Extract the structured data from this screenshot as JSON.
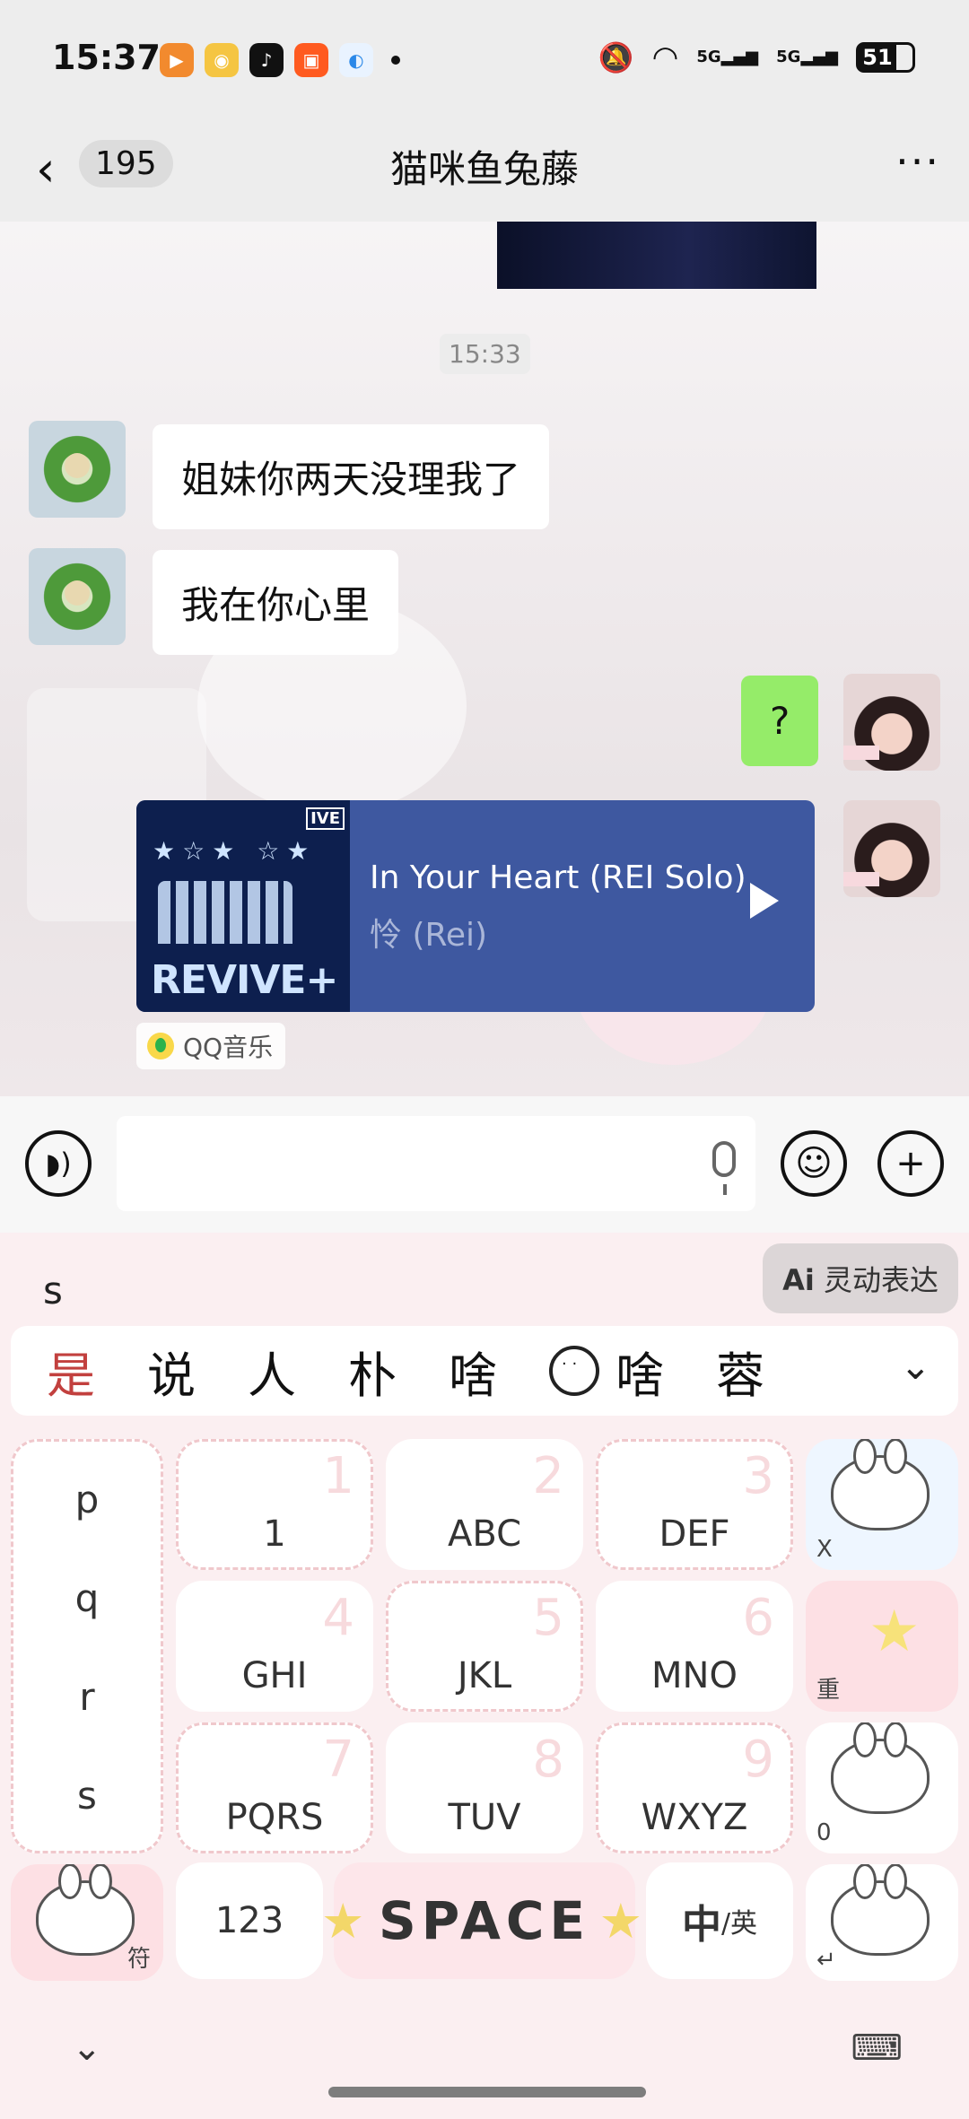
{
  "status_bar": {
    "time": "15:37",
    "app_icons": [
      "video-app-icon",
      "weibo-icon",
      "tiktok-icon",
      "kuaishou-icon",
      "browser-icon"
    ],
    "network_label_1": "5G",
    "network_label_2": "5G",
    "battery": "51"
  },
  "header": {
    "back_count": "195",
    "title": "猫咪鱼兔藤",
    "more": "···"
  },
  "chat": {
    "timestamp": "15:33",
    "messages": [
      {
        "side": "left",
        "text": "姐妹你两天没理我了"
      },
      {
        "side": "left",
        "text": "我在你心里"
      },
      {
        "side": "right",
        "text": "?"
      }
    ],
    "music_card": {
      "song": "In Your Heart (REI Solo)",
      "artist": "怜 (Rei)",
      "cover_text": "REVIVE+",
      "cover_badge": "IVE",
      "source": "QQ音乐"
    }
  },
  "keyboard": {
    "pinyin": "s",
    "ai_button_prefix": "Ai",
    "ai_button_label": "灵动表达",
    "candidates": [
      "是",
      "说",
      "人",
      "朴",
      "啥",
      "啥",
      "蓉"
    ],
    "side_letters": [
      "p",
      "q",
      "r",
      "s"
    ],
    "keys": [
      {
        "label": "1",
        "num": "1"
      },
      {
        "label": "ABC",
        "num": "2"
      },
      {
        "label": "DEF",
        "num": "3"
      },
      {
        "label": "GHI",
        "num": "4"
      },
      {
        "label": "JKL",
        "num": "5"
      },
      {
        "label": "MNO",
        "num": "6"
      },
      {
        "label": "PQRS",
        "num": "7"
      },
      {
        "label": "TUV",
        "num": "8"
      },
      {
        "label": "WXYZ",
        "num": "9"
      }
    ],
    "right_keys": [
      "X",
      "重",
      "0",
      "↵"
    ],
    "symbol_key": "符",
    "num_key": "123",
    "space": "SPACE",
    "lang_key_main": "中",
    "lang_key_sub": "/英"
  },
  "colors": {
    "accent_green": "#95ec69",
    "music_card": "#3e58a0",
    "first_candidate": "#c2403e"
  }
}
